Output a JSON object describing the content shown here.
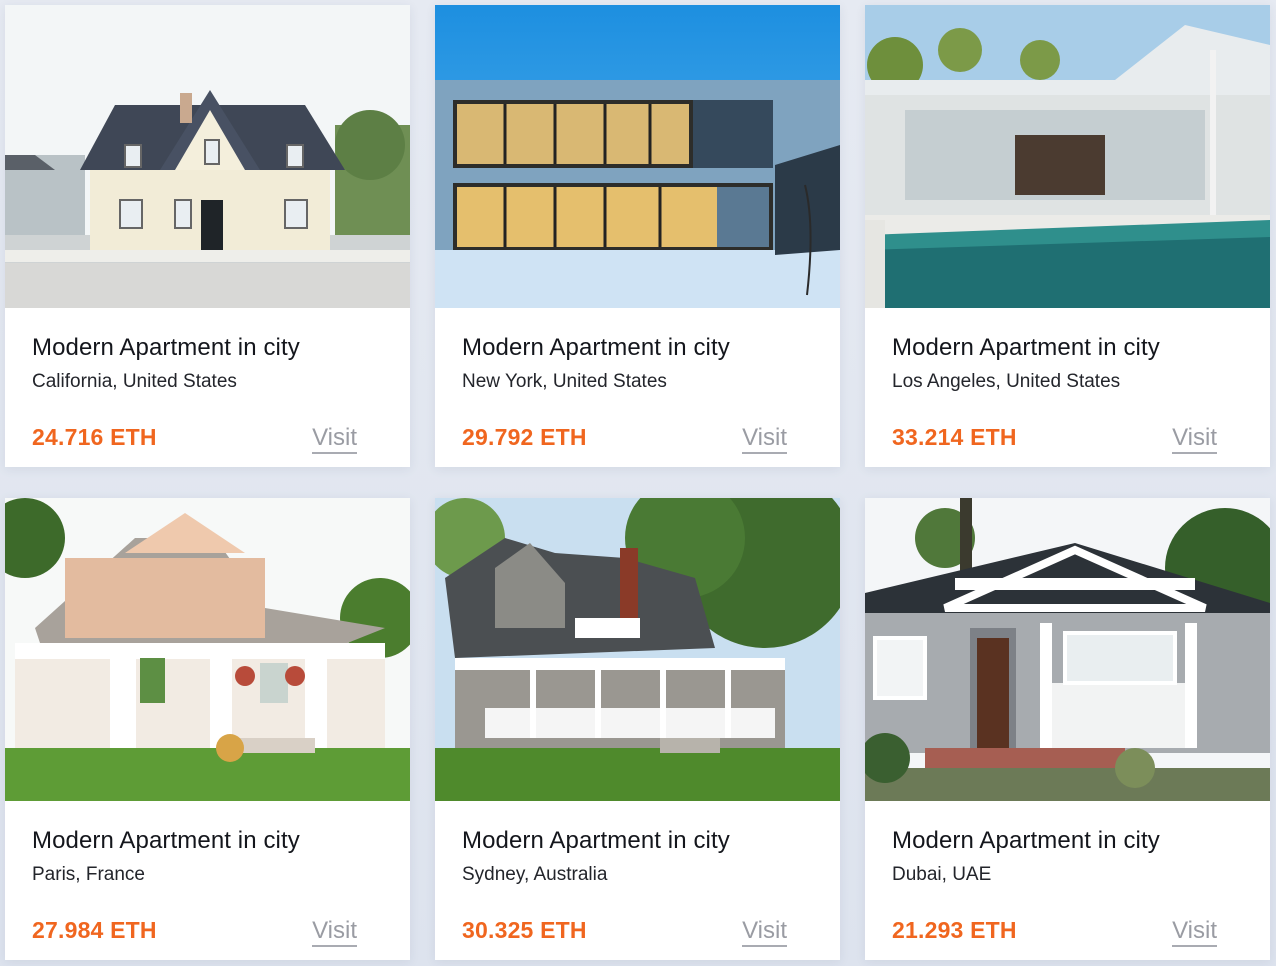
{
  "listings": [
    {
      "title": "Modern Apartment in city",
      "location": "California, United States",
      "price": "24.716 ETH",
      "visit_label": "Visit",
      "image": "cottage-house-photo"
    },
    {
      "title": "Modern Apartment in city",
      "location": "New York, United States",
      "price": "29.792 ETH",
      "visit_label": "Visit",
      "image": "glass-modern-house-photo"
    },
    {
      "title": "Modern Apartment in city",
      "location": "Los Angeles, United States",
      "price": "33.214 ETH",
      "visit_label": "Visit",
      "image": "pool-villa-photo"
    },
    {
      "title": "Modern Apartment in city",
      "location": "Paris, France",
      "price": "27.984 ETH",
      "visit_label": "Visit",
      "image": "porch-house-photo"
    },
    {
      "title": "Modern Apartment in city",
      "location": "Sydney, Australia",
      "price": "30.325 ETH",
      "visit_label": "Visit",
      "image": "shingle-house-photo"
    },
    {
      "title": "Modern Apartment in city",
      "location": "Dubai, UAE",
      "price": "21.293 ETH",
      "visit_label": "Visit",
      "image": "bungalow-house-photo"
    }
  ],
  "colors": {
    "price": "#f0661f",
    "visit": "#9a9ca3",
    "background": "#e2e7f0"
  }
}
